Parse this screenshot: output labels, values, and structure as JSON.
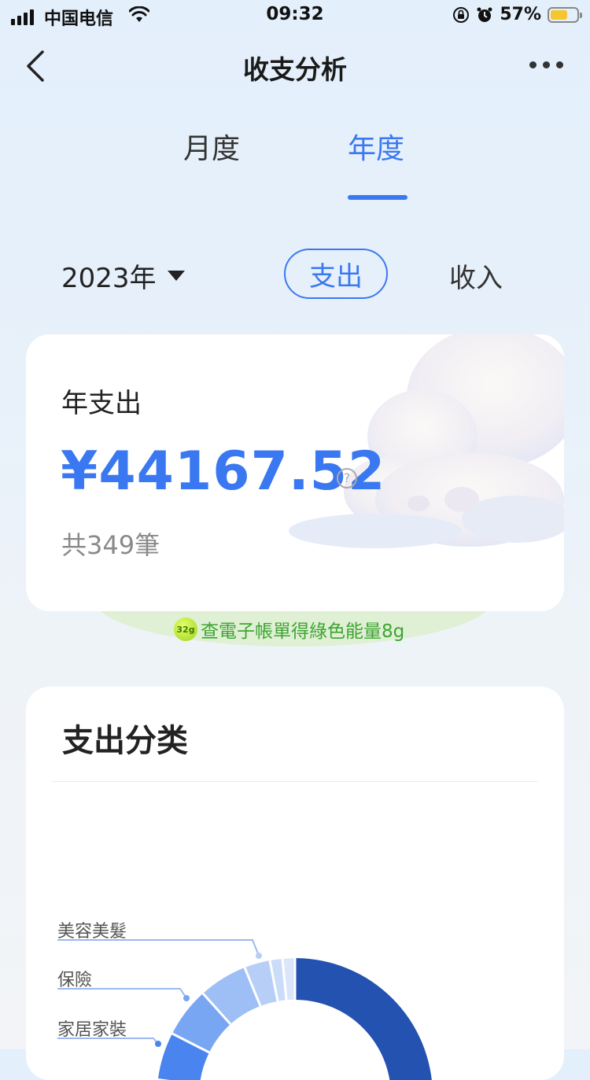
{
  "status_bar": {
    "carrier": "中国电信",
    "time": "09:32",
    "battery_percent": "57%",
    "battery_level": 0.57,
    "icons": [
      "signal-icon",
      "wifi-icon",
      "rotation-lock-icon",
      "alarm-icon",
      "battery-icon"
    ]
  },
  "nav": {
    "title": "收支分析",
    "back_icon": "chevron-left-icon",
    "more_icon": "more-dots-icon"
  },
  "period_tabs": {
    "items": [
      {
        "label": "月度",
        "active": false
      },
      {
        "label": "年度",
        "active": true
      }
    ]
  },
  "filters": {
    "year": "2023年",
    "toggle": [
      {
        "label": "支出",
        "selected": true
      },
      {
        "label": "收入",
        "selected": false
      }
    ]
  },
  "summary": {
    "label": "年支出",
    "amount": "¥44167.52",
    "help_icon": "?",
    "count": "共349筆"
  },
  "green_energy": {
    "badge": "32g",
    "text": "查電子帳單得綠色能量8g"
  },
  "category": {
    "title": "支出分类",
    "labels": [
      "美容美髮",
      "保險",
      "家居家裝"
    ]
  },
  "colors": {
    "accent": "#3a78f2",
    "donut_main": "#2452b0",
    "green_text": "#3fa433"
  }
}
